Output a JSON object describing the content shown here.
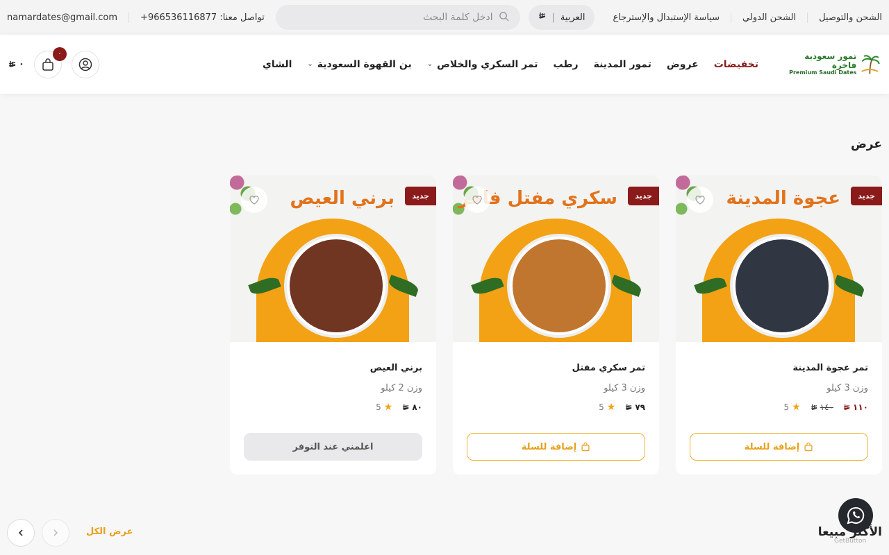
{
  "topbar": {
    "links": [
      "الشحن والتوصيل",
      "الشحن الدولي",
      "سياسة الإستبدال والإسترجاع"
    ],
    "language": "العربية",
    "currency_symbol": "⃁",
    "search_placeholder": "ادخل كلمة البحث",
    "contact_label": "تواصل معنا:",
    "phone": "+966536116877",
    "email": "namardates@gmail.com"
  },
  "header": {
    "logo_ar": "تمور سعودية فاخرة",
    "logo_en": "Premium Saudi Dates",
    "nav": [
      {
        "label": "تخفيضات",
        "highlight": true,
        "dropdown": false
      },
      {
        "label": "عروض",
        "highlight": false,
        "dropdown": false
      },
      {
        "label": "تمور المدينة",
        "highlight": false,
        "dropdown": false
      },
      {
        "label": "رطب",
        "highlight": false,
        "dropdown": false
      },
      {
        "label": "تمر السكري والخلاص",
        "highlight": false,
        "dropdown": true
      },
      {
        "label": "بن القهوة السعودية",
        "highlight": false,
        "dropdown": true
      },
      {
        "label": "الشاي",
        "highlight": false,
        "dropdown": false
      }
    ],
    "cart_count": "٠",
    "cart_total": "٠",
    "accent": "#8b1a1a"
  },
  "offers": {
    "title": "عرض",
    "products": [
      {
        "banner": "عجوة المدينة",
        "badge": "جديد",
        "name": "تمر عجوة المدينة",
        "weight": "وزن 3 كيلو",
        "price": "١١٠",
        "old_price": "١٤٠",
        "rating": "5",
        "button": "إضافة للسلة",
        "available": true,
        "date_color": "#2e3440"
      },
      {
        "banner": "سكري مفتل فاخر",
        "badge": "جديد",
        "name": "تمر سكري مفتل",
        "weight": "وزن 3 كيلو",
        "price": "٧٩",
        "old_price": "",
        "rating": "5",
        "button": "إضافة للسلة",
        "available": true,
        "date_color": "#b8702e"
      },
      {
        "banner": "برني العيص",
        "badge": "جديد",
        "name": "برني العيص",
        "weight": "وزن 2 كيلو",
        "price": "٨٠",
        "old_price": "",
        "rating": "5",
        "button": "اعلمني عند التوفر",
        "available": false,
        "date_color": "#6b3320"
      }
    ]
  },
  "best_sellers": {
    "title": "الأكثر مبيعا",
    "view_all": "عرض الكل"
  },
  "widget": {
    "getbutton": "GetButton"
  }
}
